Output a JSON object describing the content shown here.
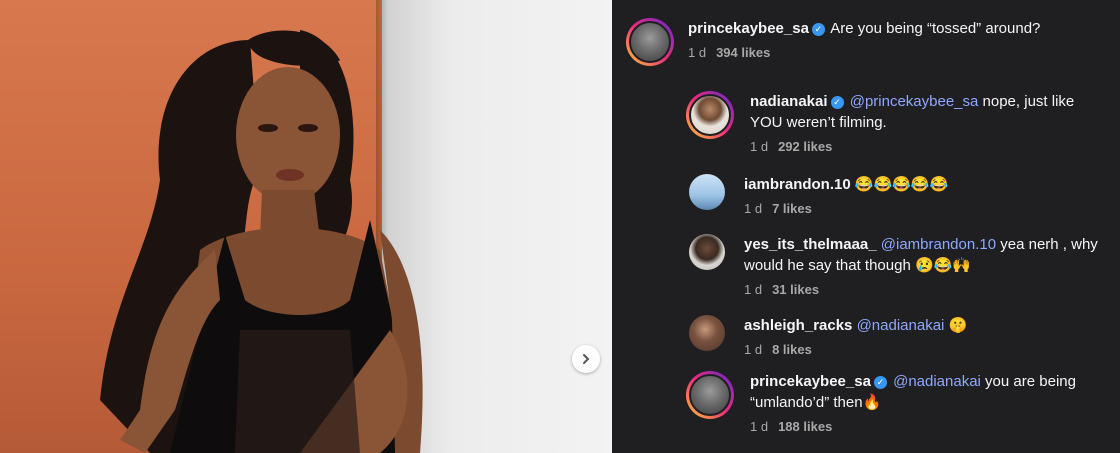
{
  "post": {
    "image_alt": "photo"
  },
  "comments": [
    {
      "user": "princekaybee_sa",
      "verified": true,
      "mention": "",
      "text": "Are you being “tossed” around?",
      "emoji": "",
      "time": "1 d",
      "likes": "394 likes"
    },
    {
      "user": "nadianakai",
      "verified": true,
      "mention": "@princekaybee_sa",
      "text": " nope, just like YOU weren’t filming.",
      "emoji": "",
      "time": "1 d",
      "likes": "292 likes"
    },
    {
      "user": "iambrandon.10",
      "verified": false,
      "mention": "",
      "text": "",
      "emoji": "😂😂😂😂😂",
      "time": "1 d",
      "likes": "7 likes"
    },
    {
      "user": "yes_its_thelmaaa_",
      "verified": false,
      "mention": "@iambrandon.10",
      "text": " yea nerh , why would he say that though ",
      "emoji": "😢😂🙌",
      "time": "1 d",
      "likes": "31 likes"
    },
    {
      "user": "ashleigh_racks",
      "verified": false,
      "mention": "@nadianakai",
      "text": " ",
      "emoji": "🤫",
      "time": "1 d",
      "likes": "8 likes"
    },
    {
      "user": "princekaybee_sa",
      "verified": true,
      "mention": "@nadianakai",
      "text": " you are being “umlando’d” then",
      "emoji": "🔥",
      "time": "1 d",
      "likes": "188 likes"
    }
  ]
}
